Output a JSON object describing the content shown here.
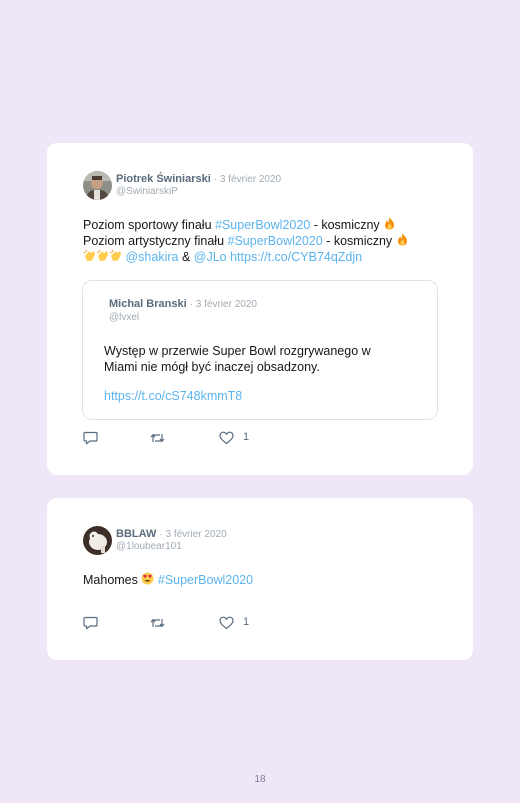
{
  "tweets": [
    {
      "author": "Piotrek Świniarski",
      "date": "· 3 février 2020",
      "handle": "@SwiniarskiP",
      "line1": {
        "a": "Poziom sportowy finału ",
        "tag": "#SuperBowl2020",
        "b": " - kosmiczny "
      },
      "line2": {
        "a": "Poziom artystyczny finału ",
        "tag": "#SuperBowl2020",
        "b": " - kosmiczny "
      },
      "line3": {
        "m1": "@shakira",
        "amp": " & ",
        "m2": "@JLo",
        "url": " https://t.co/CYB74qZdjn"
      },
      "quote": {
        "author": "Michal Branski",
        "date": "· 3 février 2020",
        "handle": "@lvxel",
        "line1": "Występ w przerwie Super Bowl rozgrywanego w",
        "line2": "Miami nie mógł być inaczej obsadzony.",
        "url": "https://t.co/cS748kmmT8"
      },
      "likes": "1"
    },
    {
      "author": "BBLAW",
      "date": "· 3 février 2020",
      "handle": "@1loubear101",
      "text": {
        "a": "Mahomes ",
        "tag": "#SuperBowl2020"
      },
      "likes": "1"
    }
  ],
  "page_number": "18",
  "colors": {
    "background": "#efe6f8",
    "link": "#5bb4ee",
    "name": "#5b6b7e",
    "meta": "#a2abb4"
  },
  "icons": [
    "reply-icon",
    "retweet-icon",
    "like-icon",
    "fire-emoji",
    "clap-emoji",
    "heart-eyes-emoji"
  ]
}
